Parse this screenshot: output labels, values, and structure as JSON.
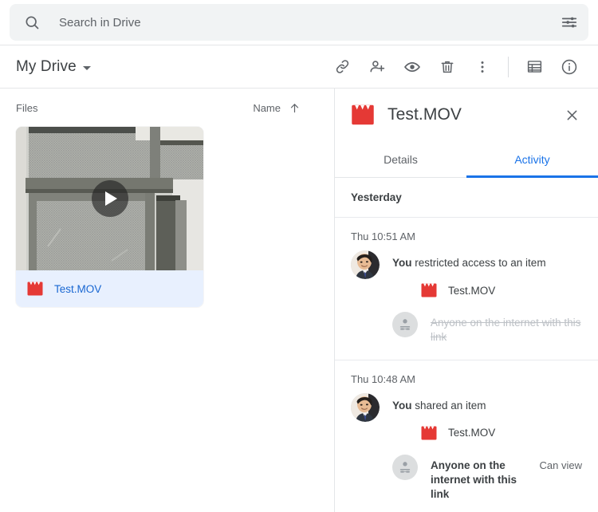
{
  "search": {
    "placeholder": "Search in Drive",
    "value": "",
    "search_icon": "search-icon",
    "filter_icon": "tune-filter-icon"
  },
  "toolbar": {
    "location_label": "My Drive",
    "icons": [
      {
        "name": "link-icon",
        "label": "Get link"
      },
      {
        "name": "person-add-icon",
        "label": "Share"
      },
      {
        "name": "eye-preview-icon",
        "label": "Preview"
      },
      {
        "name": "trash-icon",
        "label": "Remove"
      },
      {
        "name": "more-vertical-icon",
        "label": "More actions"
      },
      {
        "name": "list-view-icon",
        "label": "List layout"
      },
      {
        "name": "info-icon",
        "label": "View details"
      }
    ]
  },
  "files_pane": {
    "section_label": "Files",
    "sort_label": "Name",
    "sort_direction_icon": "arrow-up-icon",
    "card": {
      "file_name": "Test.MOV",
      "file_type_icon": "video-clapperboard-icon",
      "play_overlay_icon": "play-icon",
      "selected": true
    }
  },
  "detail_panel": {
    "title": "Test.MOV",
    "file_type_icon": "video-clapperboard-icon",
    "close_icon": "close-icon",
    "tabs": [
      {
        "label": "Details",
        "active": false
      },
      {
        "label": "Activity",
        "active": true
      }
    ],
    "day_header": "Yesterday",
    "entries": [
      {
        "time": "Thu 10:51 AM",
        "actor": "You",
        "action": " restricted access to an item",
        "file_name": "Test.MOV",
        "file_type_icon": "video-clapperboard-icon",
        "permission_label": "Anyone on the internet with this link",
        "permission_icon": "person-link-icon",
        "permission_role": "",
        "revoked": true
      },
      {
        "time": "Thu 10:48 AM",
        "actor": "You",
        "action": " shared an item",
        "file_name": "Test.MOV",
        "file_type_icon": "video-clapperboard-icon",
        "permission_label": "Anyone on the internet with this link",
        "permission_icon": "person-link-icon",
        "permission_role": "Can view",
        "revoked": false
      }
    ]
  },
  "colors": {
    "accent_blue": "#1a73e8",
    "selected_chip": "#e8f0fe",
    "selected_text": "#1967d2",
    "video_red": "#e53935",
    "text_primary": "#3c4043",
    "text_secondary": "#5f6368"
  }
}
